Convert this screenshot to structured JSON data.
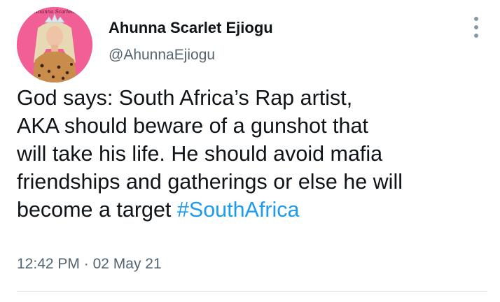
{
  "tweet": {
    "author": {
      "name": "Ahunna Scarlet Ejiogu",
      "handle": "@AhunnaEjiogu",
      "avatar_caption": "Ahunna Scarlett"
    },
    "more_icon": "more-vertical-icon",
    "text_lines": [
      "God says: South Africa’s Rap artist,",
      "AKA should beware of a gunshot that",
      "will take his life. He should avoid mafia",
      "friendships and gatherings or else he will",
      "become a target "
    ],
    "hashtag": "#SouthAfrica",
    "time": "12:42 PM",
    "separator": "·",
    "date": "02 May 21"
  },
  "colors": {
    "text": "#0f1419",
    "secondary": "#536471",
    "link": "#1d9bf0",
    "avatar_bg": "#f25f96"
  }
}
